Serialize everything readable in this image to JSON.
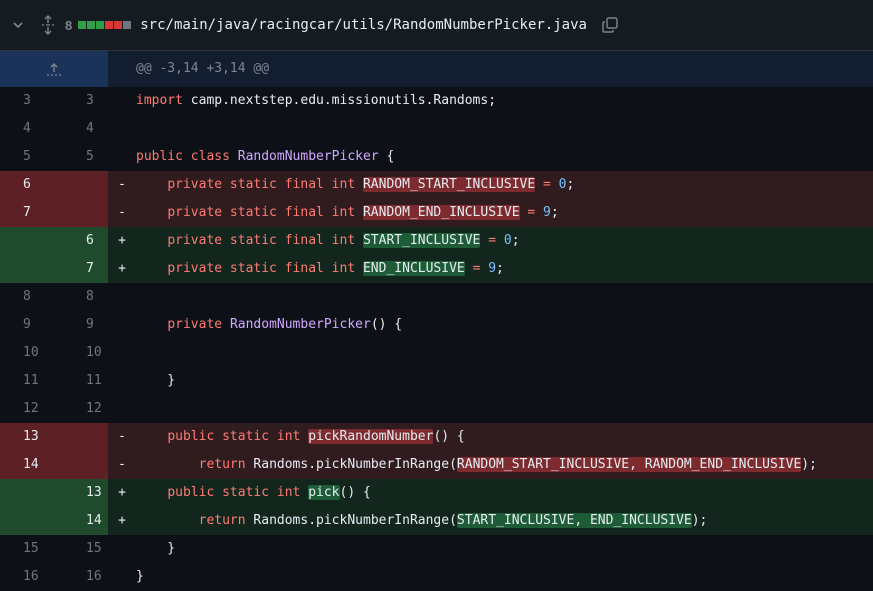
{
  "file": {
    "change_count": "8",
    "path": "src/main/java/racingcar/utils/RandomNumberPicker.java",
    "diffstat": [
      "add",
      "add",
      "add",
      "del",
      "del",
      "neutral"
    ]
  },
  "hunk": {
    "header": "@@ -3,14 +3,14 @@"
  },
  "lines": [
    {
      "type": "ctx",
      "old": "3",
      "new": "3",
      "marker": "",
      "tokens": [
        {
          "t": "import",
          "c": "kw"
        },
        {
          "t": " camp.nextstep.edu.missionutils.Randoms;"
        }
      ]
    },
    {
      "type": "ctx",
      "old": "4",
      "new": "4",
      "marker": "",
      "tokens": []
    },
    {
      "type": "ctx",
      "old": "5",
      "new": "5",
      "marker": "",
      "tokens": [
        {
          "t": "public class",
          "c": "kw"
        },
        {
          "t": " "
        },
        {
          "t": "RandomNumberPicker",
          "c": "cls"
        },
        {
          "t": " {"
        }
      ]
    },
    {
      "type": "del",
      "old": "6",
      "new": "",
      "marker": "-",
      "tokens": [
        {
          "t": "    "
        },
        {
          "t": "private static final int",
          "c": "kw"
        },
        {
          "t": " "
        },
        {
          "t": "RANDOM_START_INCLUSIVE",
          "c": "hl-del"
        },
        {
          "t": " "
        },
        {
          "t": "=",
          "c": "kw"
        },
        {
          "t": " "
        },
        {
          "t": "0",
          "c": "num"
        },
        {
          "t": ";"
        }
      ]
    },
    {
      "type": "del",
      "old": "7",
      "new": "",
      "marker": "-",
      "tokens": [
        {
          "t": "    "
        },
        {
          "t": "private static final int",
          "c": "kw"
        },
        {
          "t": " "
        },
        {
          "t": "RANDOM_END_INCLUSIVE",
          "c": "hl-del"
        },
        {
          "t": " "
        },
        {
          "t": "=",
          "c": "kw"
        },
        {
          "t": " "
        },
        {
          "t": "9",
          "c": "num"
        },
        {
          "t": ";"
        }
      ]
    },
    {
      "type": "add",
      "old": "",
      "new": "6",
      "marker": "+",
      "tokens": [
        {
          "t": "    "
        },
        {
          "t": "private static final int",
          "c": "kw"
        },
        {
          "t": " "
        },
        {
          "t": "START_INCLUSIVE",
          "c": "hl-add"
        },
        {
          "t": " "
        },
        {
          "t": "=",
          "c": "kw"
        },
        {
          "t": " "
        },
        {
          "t": "0",
          "c": "num"
        },
        {
          "t": ";"
        }
      ]
    },
    {
      "type": "add",
      "old": "",
      "new": "7",
      "marker": "+",
      "tokens": [
        {
          "t": "    "
        },
        {
          "t": "private static final int",
          "c": "kw"
        },
        {
          "t": " "
        },
        {
          "t": "END_INCLUSIVE",
          "c": "hl-add"
        },
        {
          "t": " "
        },
        {
          "t": "=",
          "c": "kw"
        },
        {
          "t": " "
        },
        {
          "t": "9",
          "c": "num"
        },
        {
          "t": ";"
        }
      ]
    },
    {
      "type": "ctx",
      "old": "8",
      "new": "8",
      "marker": "",
      "tokens": []
    },
    {
      "type": "ctx",
      "old": "9",
      "new": "9",
      "marker": "",
      "tokens": [
        {
          "t": "    "
        },
        {
          "t": "private",
          "c": "kw"
        },
        {
          "t": " "
        },
        {
          "t": "RandomNumberPicker",
          "c": "cls"
        },
        {
          "t": "() {"
        }
      ]
    },
    {
      "type": "ctx",
      "old": "10",
      "new": "10",
      "marker": "",
      "tokens": []
    },
    {
      "type": "ctx",
      "old": "11",
      "new": "11",
      "marker": "",
      "tokens": [
        {
          "t": "    }"
        }
      ]
    },
    {
      "type": "ctx",
      "old": "12",
      "new": "12",
      "marker": "",
      "tokens": []
    },
    {
      "type": "del",
      "old": "13",
      "new": "",
      "marker": "-",
      "tokens": [
        {
          "t": "    "
        },
        {
          "t": "public static int",
          "c": "kw"
        },
        {
          "t": " "
        },
        {
          "t": "pickRandomNumber",
          "c": "hl-del"
        },
        {
          "t": "() {"
        }
      ]
    },
    {
      "type": "del",
      "old": "14",
      "new": "",
      "marker": "-",
      "tokens": [
        {
          "t": "        "
        },
        {
          "t": "return",
          "c": "kw"
        },
        {
          "t": " Randoms.pickNumberInRange("
        },
        {
          "t": "RANDOM_START_INCLUSIVE, RANDOM_END_INCLUSIVE",
          "c": "hl-del"
        },
        {
          "t": ");"
        }
      ]
    },
    {
      "type": "add",
      "old": "",
      "new": "13",
      "marker": "+",
      "tokens": [
        {
          "t": "    "
        },
        {
          "t": "public static int",
          "c": "kw"
        },
        {
          "t": " "
        },
        {
          "t": "pick",
          "c": "hl-add"
        },
        {
          "t": "() {"
        }
      ]
    },
    {
      "type": "add",
      "old": "",
      "new": "14",
      "marker": "+",
      "tokens": [
        {
          "t": "        "
        },
        {
          "t": "return",
          "c": "kw"
        },
        {
          "t": " Randoms.pickNumberInRange("
        },
        {
          "t": "START_INCLUSIVE, END_INCLUSIVE",
          "c": "hl-add"
        },
        {
          "t": ");"
        }
      ]
    },
    {
      "type": "ctx",
      "old": "15",
      "new": "15",
      "marker": "",
      "tokens": [
        {
          "t": "    }"
        }
      ]
    },
    {
      "type": "ctx",
      "old": "16",
      "new": "16",
      "marker": "",
      "tokens": [
        {
          "t": "}"
        }
      ]
    }
  ]
}
